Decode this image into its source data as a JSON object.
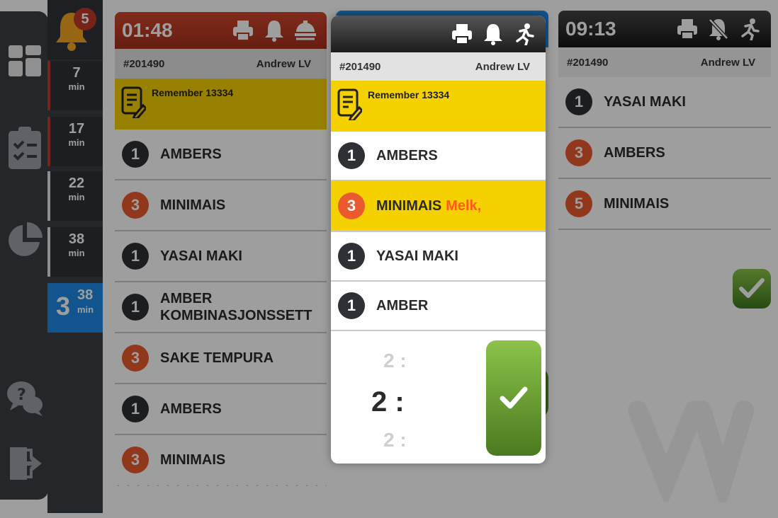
{
  "notifications": {
    "count": "5",
    "accent": "#f5a623"
  },
  "nav": {
    "icons": [
      "dashboard-icon",
      "orders-checklist-icon",
      "pie-chart-icon",
      "help-chat-icon",
      "logout-icon"
    ]
  },
  "timers": [
    {
      "value": "7",
      "unit": "min"
    },
    {
      "value": "17",
      "unit": "min"
    },
    {
      "value": "22",
      "unit": "min"
    },
    {
      "value": "38",
      "unit": "min"
    },
    {
      "value": "3",
      "sub": "38",
      "unit": "min"
    }
  ],
  "tickets": {
    "left": {
      "time": "01:48",
      "header_color": "#c0392b",
      "order": "#201490",
      "waiter": "Andrew LV",
      "note": "Remember 13334",
      "items": [
        {
          "qty": "1",
          "name": "AMBERS",
          "style": "dark"
        },
        {
          "qty": "3",
          "name": "MINIMAIS",
          "style": "orange"
        },
        {
          "qty": "1",
          "name": "YASAI MAKI",
          "style": "dark"
        },
        {
          "qty": "1",
          "name": "AMBER KOMBINASJONSSETT",
          "style": "dark"
        },
        {
          "qty": "3",
          "name": "SAKE TEMPURA",
          "style": "orange"
        },
        {
          "qty": "1",
          "name": "AMBERS",
          "style": "dark"
        },
        {
          "qty": "3",
          "name": "MINIMAIS",
          "style": "orange"
        }
      ]
    },
    "focused": {
      "order": "#201490",
      "waiter": "Andrew LV",
      "note": "Remember 13334",
      "items": [
        {
          "qty": "1",
          "name": "AMBERS",
          "style": "dark"
        },
        {
          "qty": "3",
          "name": "MINIMAIS",
          "modifier": "Melk,",
          "style": "orange",
          "highlight": true
        },
        {
          "qty": "1",
          "name": "YASAI MAKI",
          "style": "dark"
        },
        {
          "qty": "1",
          "name": "AMBER",
          "style": "dark"
        }
      ],
      "picker": {
        "above": "2 :",
        "selected": "2 :",
        "below": "2 :"
      }
    },
    "right": {
      "time": "09:13",
      "order": "#201490",
      "waiter": "Andrew LV",
      "items": [
        {
          "qty": "1",
          "name": "YASAI MAKI",
          "style": "dark"
        },
        {
          "qty": "3",
          "name": "AMBERS",
          "style": "orange"
        },
        {
          "qty": "5",
          "name": "MINIMAIS",
          "style": "orange"
        }
      ]
    }
  }
}
